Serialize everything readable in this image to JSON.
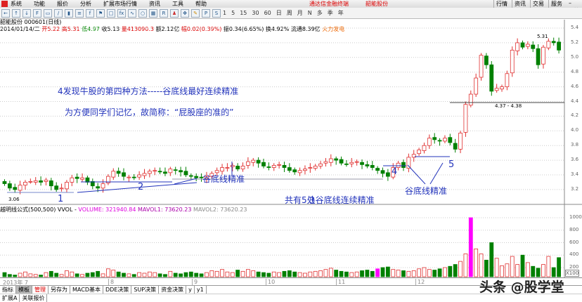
{
  "menu": {
    "items": [
      "系统",
      "功能",
      "报价",
      "分析",
      "扩展市场行情",
      "资讯",
      "工具",
      "帮助"
    ],
    "promo": "通达信金融终端",
    "promo2": "韶能股份",
    "right": [
      "行情",
      "资讯",
      "交易",
      "服务"
    ]
  },
  "toolbar": {
    "periods": [
      "1",
      "5",
      "15",
      "30",
      "60",
      "日",
      "周",
      "月",
      "N",
      "多",
      "季",
      "年"
    ]
  },
  "info": {
    "line1": "韶能股份 000601(日线)",
    "date": "2014/01/14/二",
    "open": "开5.22",
    "high": "高5.31",
    "low": "低4.97",
    "close": "收5.13",
    "vol": "量413090.3",
    "amount": "额2.12亿",
    "change": "幅0.02(0.39%)",
    "turn": "振0.34(6.65%)",
    "hs": "换4.92%",
    "float": "流通8.39亿",
    "sector": "火力发电"
  },
  "annotations": {
    "title": "4发现牛股的第四种方法-----谷底线最好连续精准",
    "subtitle": "为方便同学们记忆，故简称：“屁股座的准的”",
    "n1": "1",
    "n2": "2",
    "n3": "3",
    "n4": "4",
    "n5": "5",
    "label_a": "谷底线精准",
    "label_b": "共有5处谷底线连续精准",
    "label_c": "谷底线精准",
    "low_mark": "3.06",
    "high_mark": "5.31",
    "gap_mark": "4.37 - 4.38"
  },
  "price_axis": [
    "5.4",
    "5.2",
    "5.0",
    "4.8",
    "4.6",
    "4.4",
    "4.2",
    "4.0",
    "3.8",
    "3.6",
    "3.4",
    "3.2"
  ],
  "volume": {
    "header": "越明线公式(500,500) VVOL -",
    "volume": "VOLUME: 321940.84",
    "mavol1": "MAVOL1: 73620.23",
    "mavol2": "MAVOL2: 73620.23",
    "axis": [
      "1000",
      "800",
      "600",
      "400",
      "200"
    ],
    "unit": "X100"
  },
  "date_axis": {
    "first": "2013年 7",
    "months": [
      "8",
      "9",
      "10",
      "11",
      "12"
    ]
  },
  "tabs": [
    "指标",
    "模板",
    "管理",
    "另存为",
    "MACD基本",
    "DDE决策",
    "SUP决策",
    "资金决策",
    "y",
    "y1"
  ],
  "tabs2": [
    "扩展A",
    "关联报价"
  ],
  "watermark": "头条 @股学堂",
  "colors": {
    "up": "#e03030",
    "down": "#008000",
    "annotation": "#2233bb",
    "magenta": "#ff00ff"
  },
  "chart_data": {
    "type": "candlestick",
    "close_prices_approx": [
      3.28,
      3.22,
      3.2,
      3.26,
      3.3,
      3.31,
      3.32,
      3.3,
      3.33,
      3.25,
      3.2,
      3.22,
      3.3,
      3.36,
      3.35,
      3.36,
      3.3,
      3.25,
      3.22,
      3.28,
      3.38,
      3.45,
      3.42,
      3.38,
      3.37,
      3.36,
      3.4,
      3.42,
      3.45,
      3.46,
      3.44,
      3.42,
      3.48,
      3.46,
      3.44,
      3.4,
      3.38,
      3.36,
      3.36,
      3.38,
      3.42,
      3.46,
      3.5,
      3.5,
      3.53,
      3.48,
      3.52,
      3.58,
      3.6,
      3.56,
      3.52,
      3.5,
      3.53,
      3.54,
      3.5,
      3.46,
      3.44,
      3.46,
      3.48,
      3.5,
      3.52,
      3.55,
      3.58,
      3.62,
      3.6,
      3.56,
      3.55,
      3.57,
      3.58,
      3.54,
      3.52,
      3.5,
      3.46,
      3.42,
      3.38,
      3.5,
      3.56,
      3.5,
      3.64,
      3.68,
      3.74,
      3.8,
      3.9,
      3.88,
      3.86,
      3.9,
      3.84,
      3.75,
      3.97,
      4.36,
      4.5,
      4.72,
      5.03,
      4.9,
      4.54,
      4.58,
      4.6,
      4.78,
      5.1,
      5.2,
      5.14,
      5.18,
      5.12,
      4.9,
      5.14,
      5.22,
      5.2,
      5.1
    ],
    "volume_x100_approx": [
      120,
      90,
      80,
      110,
      130,
      100,
      90,
      80,
      120,
      140,
      110,
      90,
      150,
      130,
      100,
      90,
      110,
      120,
      140,
      100,
      180,
      160,
      130,
      110,
      100,
      90,
      120,
      110,
      130,
      120,
      100,
      90,
      140,
      110,
      100,
      120,
      130,
      110,
      100,
      120,
      150,
      140,
      170,
      130,
      120,
      160,
      140,
      170,
      150,
      130,
      120,
      110,
      130,
      120,
      140,
      150,
      130,
      120,
      110,
      130,
      140,
      150,
      170,
      190,
      160,
      140,
      130,
      120,
      130,
      150,
      160,
      140,
      180,
      200,
      210,
      170,
      160,
      150,
      140,
      150,
      180,
      200,
      170,
      160,
      180,
      200,
      220,
      250,
      300,
      420,
      1000,
      500,
      420,
      320,
      600,
      350,
      230,
      260,
      380,
      250,
      400,
      280,
      220,
      190,
      250,
      380,
      200,
      360
    ]
  }
}
